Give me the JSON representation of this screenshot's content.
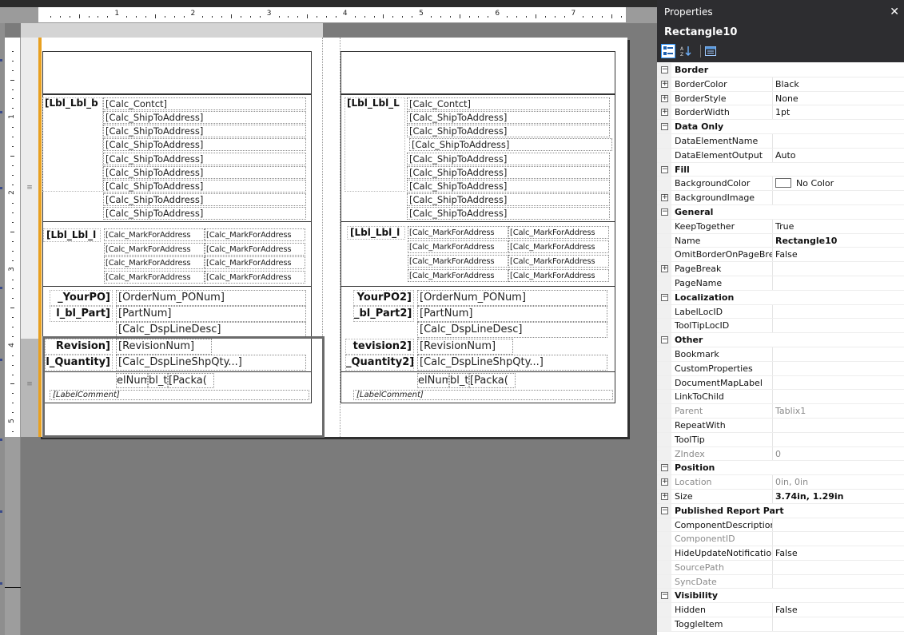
{
  "ruler": {
    "top_numbers": [
      "1",
      "2",
      "3",
      "4",
      "5",
      "6",
      "7"
    ],
    "left_numbers": [
      "1",
      "2",
      "3",
      "4",
      "5"
    ]
  },
  "report": {
    "left": {
      "header_label": "[Lbl_Lbl_b",
      "contact": "[Calc_Contct]",
      "ship_to": [
        "[Calc_ShipToAddress]",
        "[Calc_ShipToAddress]",
        "[Calc_ShipToAddress]",
        "[Calc_ShipToAddress]",
        "[Calc_ShipToAddress]",
        "[Calc_ShipToAddress]",
        "[Calc_ShipToAddress]",
        "[Calc_ShipToAddress]"
      ],
      "markfor_label": "[Lbl_Lbl_l",
      "markfor": [
        "[Calc_MarkForAddress",
        "[Calc_MarkForAddress",
        "[Calc_MarkForAddress",
        "[Calc_MarkForAddress",
        "[Calc_MarkForAddress",
        "[Calc_MarkForAddress",
        "[Calc_MarkForAddress",
        "[Calc_MarkForAddress"
      ],
      "yourpo_label": "_YourPO]",
      "ordernum": "[OrderNum_PONum]",
      "part_label": "l_bl_Part]",
      "partnum": "[PartNum]",
      "linedesc": "[Calc_DspLineDesc]",
      "revision_label": "Revision]",
      "revisionnum": "[RevisionNum]",
      "quantity_label": "l_Quantity]",
      "shpqty": "[Calc_DspLineShpQty...]",
      "elnum": "elNum]",
      "blt": "bl_t",
      "package": "[Packa(",
      "comment": "[LabelComment]"
    },
    "right": {
      "header_label": "[Lbl_Lbl_L",
      "contact": "[Calc_Contct]",
      "ship_to": [
        "[Calc_ShipToAddress]",
        "[Calc_ShipToAddress]",
        "[Calc_ShipToAddress]",
        "[Calc_ShipToAddress]",
        "[Calc_ShipToAddress]",
        "[Calc_ShipToAddress]",
        "[Calc_ShipToAddress]",
        "[Calc_ShipToAddress]"
      ],
      "markfor_label": "[Lbl_Lbl_l",
      "markfor": [
        "[Calc_MarkForAddress",
        "[Calc_MarkForAddress",
        "[Calc_MarkForAddress",
        "[Calc_MarkForAddress",
        "[Calc_MarkForAddress",
        "[Calc_MarkForAddress",
        "[Calc_MarkForAddress",
        "[Calc_MarkForAddress"
      ],
      "yourpo_label": "YourPO2]",
      "ordernum": "[OrderNum_PONum]",
      "part_label": "_bl_Part2]",
      "partnum": "[PartNum]",
      "linedesc": "[Calc_DspLineDesc]",
      "revision_label": "tevision2]",
      "revisionnum": "[RevisionNum]",
      "quantity_label": "_Quantity2]",
      "shpqty": "[Calc_DspLineShpQty...]",
      "elnum": "elNum]",
      "blt": "bl_t",
      "package": "[Packa(",
      "comment": "[LabelComment]"
    }
  },
  "properties": {
    "title": "Properties",
    "close_glyph": "✕",
    "object_name": "Rectangle10",
    "rows": [
      {
        "kind": "cat",
        "name": "Border",
        "exp": "−"
      },
      {
        "kind": "prop",
        "name": "BorderColor",
        "value": "Black",
        "exp": "+"
      },
      {
        "kind": "prop",
        "name": "BorderStyle",
        "value": "None",
        "exp": "+"
      },
      {
        "kind": "prop",
        "name": "BorderWidth",
        "value": "1pt",
        "exp": "+"
      },
      {
        "kind": "cat",
        "name": "Data Only",
        "exp": "−"
      },
      {
        "kind": "prop",
        "name": "DataElementName",
        "value": ""
      },
      {
        "kind": "prop",
        "name": "DataElementOutput",
        "value": "Auto"
      },
      {
        "kind": "cat",
        "name": "Fill",
        "exp": "−"
      },
      {
        "kind": "prop",
        "name": "BackgroundColor",
        "value": "No Color",
        "swatch": true
      },
      {
        "kind": "prop",
        "name": "BackgroundImage",
        "value": "",
        "exp": "+"
      },
      {
        "kind": "cat",
        "name": "General",
        "exp": "−"
      },
      {
        "kind": "prop",
        "name": "KeepTogether",
        "value": "True"
      },
      {
        "kind": "prop",
        "name": "Name",
        "value": "Rectangle10",
        "bold": true
      },
      {
        "kind": "prop",
        "name": "OmitBorderOnPageBrea",
        "value": "False"
      },
      {
        "kind": "prop",
        "name": "PageBreak",
        "value": "",
        "exp": "+"
      },
      {
        "kind": "prop",
        "name": "PageName",
        "value": ""
      },
      {
        "kind": "cat",
        "name": "Localization",
        "exp": "−"
      },
      {
        "kind": "prop",
        "name": "LabelLocID",
        "value": ""
      },
      {
        "kind": "prop",
        "name": "ToolTipLocID",
        "value": ""
      },
      {
        "kind": "cat",
        "name": "Other",
        "exp": "−"
      },
      {
        "kind": "prop",
        "name": "Bookmark",
        "value": ""
      },
      {
        "kind": "prop",
        "name": "CustomProperties",
        "value": ""
      },
      {
        "kind": "prop",
        "name": "DocumentMapLabel",
        "value": ""
      },
      {
        "kind": "prop",
        "name": "LinkToChild",
        "value": ""
      },
      {
        "kind": "prop",
        "name": "Parent",
        "value": "Tablix1",
        "dim": true
      },
      {
        "kind": "prop",
        "name": "RepeatWith",
        "value": ""
      },
      {
        "kind": "prop",
        "name": "ToolTip",
        "value": ""
      },
      {
        "kind": "prop",
        "name": "ZIndex",
        "value": "0",
        "dim": true
      },
      {
        "kind": "cat",
        "name": "Position",
        "exp": "−"
      },
      {
        "kind": "prop",
        "name": "Location",
        "value": "0in, 0in",
        "exp": "+",
        "dim": true
      },
      {
        "kind": "prop",
        "name": "Size",
        "value": "3.74in, 1.29in",
        "exp": "+",
        "bold": true
      },
      {
        "kind": "cat",
        "name": "Published Report Part",
        "exp": "−"
      },
      {
        "kind": "prop",
        "name": "ComponentDescription",
        "value": ""
      },
      {
        "kind": "prop",
        "name": "ComponentID",
        "value": "",
        "dim": true
      },
      {
        "kind": "prop",
        "name": "HideUpdateNotification",
        "value": "False"
      },
      {
        "kind": "prop",
        "name": "SourcePath",
        "value": "",
        "dim": true
      },
      {
        "kind": "prop",
        "name": "SyncDate",
        "value": "",
        "dim": true
      },
      {
        "kind": "cat",
        "name": "Visibility",
        "exp": "−"
      },
      {
        "kind": "prop",
        "name": "Hidden",
        "value": "False"
      },
      {
        "kind": "prop",
        "name": "ToggleItem",
        "value": ""
      }
    ]
  }
}
